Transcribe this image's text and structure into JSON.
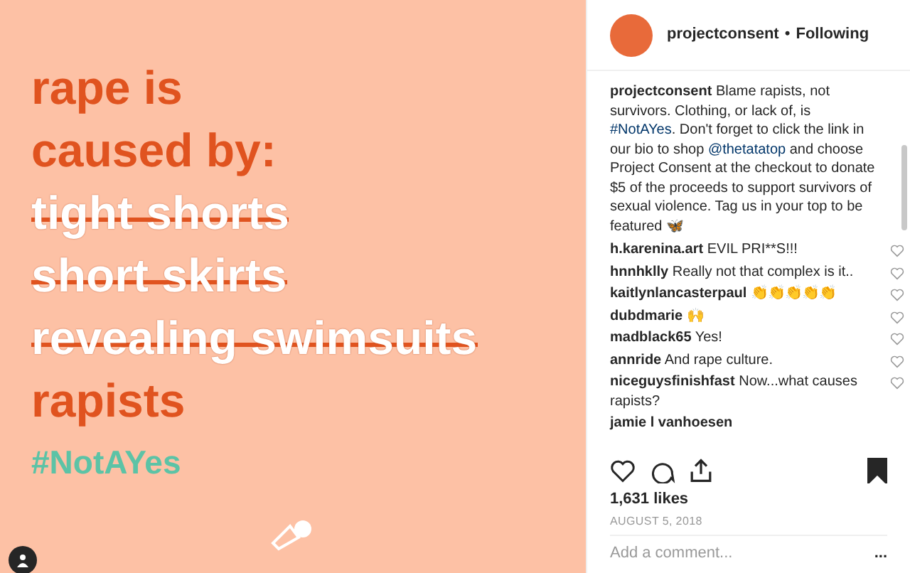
{
  "post_image": {
    "lines": [
      {
        "text": "rape is",
        "struck": false
      },
      {
        "text": "caused by:",
        "struck": false
      },
      {
        "text": "tight shorts",
        "struck": true
      },
      {
        "text": "short skirts",
        "struck": true
      },
      {
        "text": "revealing swimsuits",
        "struck": true
      },
      {
        "text": "rapists",
        "struck": false
      }
    ],
    "hashtag": "#NotAYes"
  },
  "header": {
    "username": "projectconsent",
    "separator": "•",
    "follow_status": "Following"
  },
  "caption": {
    "username": "projectconsent",
    "text": "Blame rapists, not survivors. Clothing, or lack of, is **#NotAYes**. Don't forget to click the link in our bio to shop **@thetatatop** and choose Project Consent at the checkout to donate $5 of the proceeds to support survivors of sexual violence. Tag us in your top to be featured 🦋"
  },
  "comments": [
    {
      "username": "h.karenina.art",
      "text": "EVIL PRI**S!!!"
    },
    {
      "username": "hnnhklly",
      "text": "Really not that complex is it.."
    },
    {
      "username": "kaitlynlancasterpaul",
      "text": "👏👏👏👏👏"
    },
    {
      "username": "dubdmarie",
      "text": "🙌"
    },
    {
      "username": "madblack65",
      "text": "Yes!"
    },
    {
      "username": "annride",
      "text": "And rape culture."
    },
    {
      "username": "niceguysfinishfast",
      "text": "Now...what causes rapists?"
    },
    {
      "username": "jamie l vanhoesen"
    }
  ],
  "actions": {
    "saved": true
  },
  "likes": "1,631 likes",
  "date": "AUGUST 5, 2018",
  "comment_field": {
    "placeholder": "Add a comment...",
    "more": "..."
  }
}
